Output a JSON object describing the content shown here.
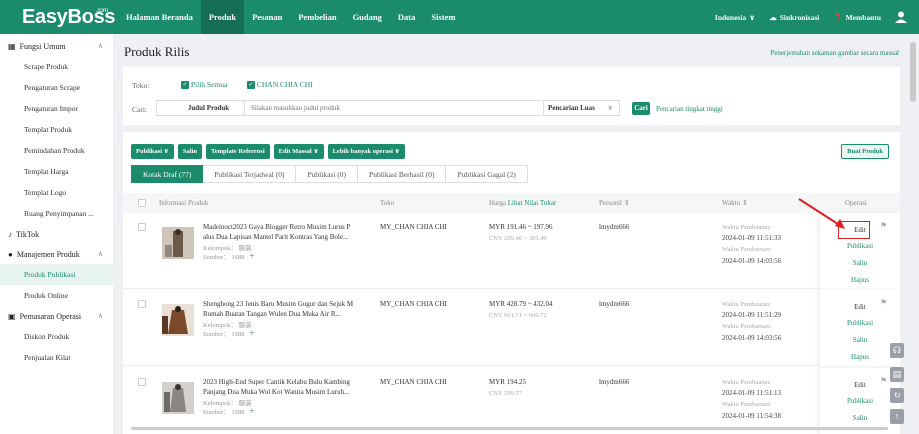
{
  "app": {
    "logo": "EasyBoss",
    "logo_suffix": ".com"
  },
  "nav": [
    "Halaman Beranda",
    "Produk",
    "Pesanan",
    "Pembelian",
    "Gudang",
    "Data",
    "Sistem"
  ],
  "top_right": {
    "country": "Indonesia",
    "sync": "Sinkronisasi",
    "help": "Membantu"
  },
  "sidebar": {
    "groups": [
      {
        "label": "Fungsi Umum",
        "items": [
          "Scrape Produk",
          "Pengaturan Scrape",
          "Pengaturan Impor",
          "Templat Produk",
          "Pemindahan Produk",
          "Templat Harga",
          "Templat Logo",
          "Ruang Penyimpanan ..."
        ]
      },
      {
        "label": "TikTok",
        "items": []
      },
      {
        "label": "Manajemen Produk",
        "items": [
          "Produk Publikasi",
          "Produk Online"
        ]
      },
      {
        "label": "Pemasaran Operasi",
        "items": [
          "Diskon Produk",
          "Penjualan Kilat"
        ]
      }
    ]
  },
  "page": {
    "title": "Produk Rilis",
    "helper_link": "Penerjemahan sekaman gambar secara massal"
  },
  "filter": {
    "store_label": "Toko:",
    "select_all": "Pilih Semua",
    "store_name": "CHAN CHIA CHI",
    "search_label": "Cari:",
    "search_field": "Judul Produk",
    "search_placeholder": "Silakan masukkan judul produk",
    "search_mode": "Pencarian Luas",
    "search_button": "Cari",
    "advanced": "Pencarian tingkat tinggi"
  },
  "toolbar": {
    "buttons": [
      "Publikasi",
      "Salin",
      "Template Referensi",
      "Edit Massal",
      "Lebih banyak operasi"
    ],
    "create": "Buat Produk"
  },
  "tabs": [
    "Kotak Draf (77)",
    "Publikasi Terjadwal (0)",
    "Publikasi (0)",
    "Publikasi Berhasil (0)",
    "Publikasi Gagal (2)"
  ],
  "table": {
    "headers": {
      "info": "Informasi Produk",
      "store": "Toko",
      "price": "Harga",
      "price_link": "Lihat Nilai Tukar",
      "person": "Personil",
      "time": "Waktu",
      "ops": "Operasi"
    },
    "rows": [
      {
        "title": "Madeinoct2023 Gaya Blogger Retro Musim Lurus P alus Dua Lapisan Mantel Parit Kontras Yang Bole...",
        "group": "Kelompok：  服装",
        "source": "Sumber：  1688",
        "store": "MY_CHAN CHIA CHI",
        "price_myr": "MYR 191.46 ~ 197.96",
        "price_cny": "CNY 295.46 ~ 305.49",
        "person": "lmydm666",
        "created_label": "Waktu Pembuatan:",
        "created": "2024-01-09 11:51:33",
        "updated_label": "Waktu Pembaruan:",
        "updated": "2024-01-09 14:03:56",
        "ops": [
          "Edit",
          "Publikasi",
          "Salin",
          "Hapus"
        ]
      },
      {
        "title": "Shenghong 23 Jenis Baru Musim Gugur dan Sejuk M Rumah Buatan Tangan Wulen Dua Muka Air R...",
        "group": "Kelompok：  服装",
        "source": "Sumber：  1688",
        "store": "MY_CHAN CHIA CHI",
        "price_myr": "MYR 428.79 ~ 432.04",
        "price_cny": "CNY 661.71 ~ 666.72",
        "person": "lmydm666",
        "created_label": "Waktu Pembuatan:",
        "created": "2024-01-09 11:51:29",
        "updated_label": "Waktu Pembaruan:",
        "updated": "2024-01-09 14:03:56",
        "ops": [
          "Edit",
          "Publikasi",
          "Salin",
          "Hapus"
        ]
      },
      {
        "title": "2023 High-End Super Cantik Kelabu Bulu Kambing Panjang Dua Muka Wol Kot Wanita Musim Luruh...",
        "group": "Kelompok：  服装",
        "source": "Sumber：  1688",
        "store": "MY_CHAN CHIA CHI",
        "price_myr": "MYR 194.25",
        "price_cny": "CNY 299.77",
        "person": "lmydm666",
        "created_label": "Waktu Pembuatan:",
        "created": "2024-01-09 11:51:13",
        "updated_label": "Waktu Pembaruan:",
        "updated": "2024-01-09 11:54:38",
        "ops": [
          "Edit",
          "Publikasi",
          "Salin"
        ]
      }
    ]
  },
  "colors": {
    "brand": "#1a8c6c",
    "highlight": "#e02020"
  }
}
